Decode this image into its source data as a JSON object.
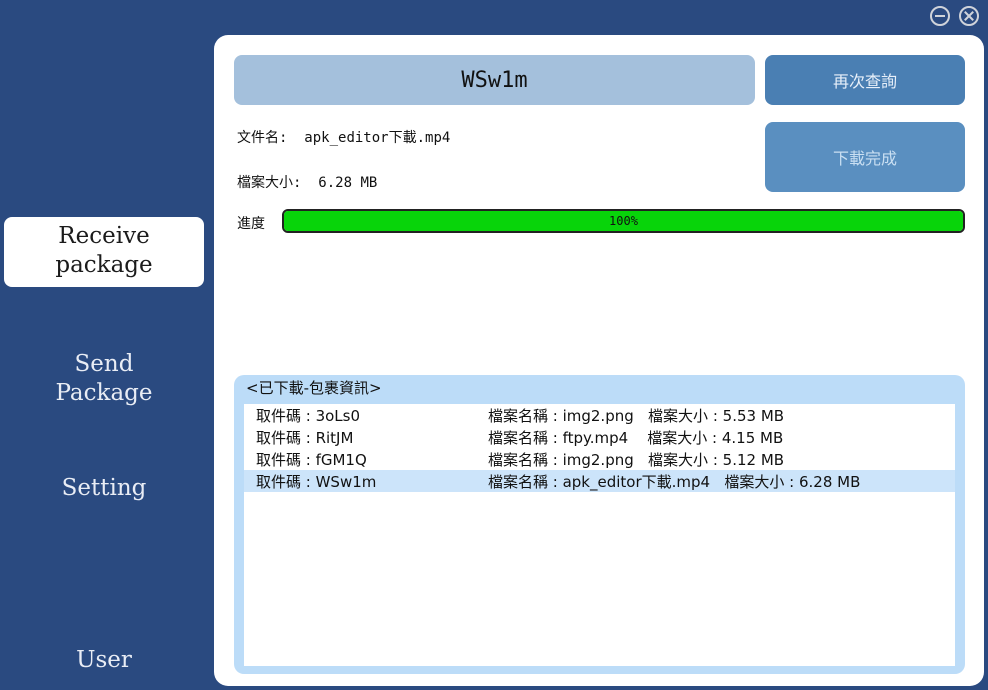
{
  "window": {
    "minimize_icon": "minimize-circle-icon",
    "close_icon": "close-circle-icon"
  },
  "sidebar": {
    "items": [
      {
        "label_line1": "Receive",
        "label_line2": "package",
        "active": true
      },
      {
        "label_line1": "Send",
        "label_line2": "Package"
      },
      {
        "label": "Setting"
      },
      {
        "label": "User"
      }
    ]
  },
  "main": {
    "code": "WSw1m",
    "query_button": "再次查詢",
    "download_button": "下載完成",
    "file_name_label": "文件名:",
    "file_name": "apk_editor下載.mp4",
    "file_size_label": "檔案大小:",
    "file_size": "6.28 MB",
    "progress_label": "進度",
    "progress_text": "100%",
    "progress_value": 100
  },
  "downloaded": {
    "title": "<已下載-包裹資訊>",
    "rows": [
      {
        "code": "取件碼 : 3oLs0",
        "info": "檔案名稱 : img2.png   檔案大小 : 5.53 MB"
      },
      {
        "code": "取件碼 : RitJM",
        "info": "檔案名稱 : ftpy.mp4    檔案大小 : 4.15 MB"
      },
      {
        "code": "取件碼 : fGM1Q",
        "info": "檔案名稱 : img2.png   檔案大小 : 5.12 MB"
      },
      {
        "code": "取件碼 : WSw1m",
        "info": "檔案名稱 : apk_editor下載.mp4   檔案大小 : 6.28 MB",
        "selected": true
      }
    ]
  },
  "colors": {
    "background": "#2a4a80",
    "accent_button": "#4a7fb3",
    "progress_fill": "#08d40a",
    "list_group": "#bcdcf8",
    "selected_row": "#cce4fa"
  }
}
